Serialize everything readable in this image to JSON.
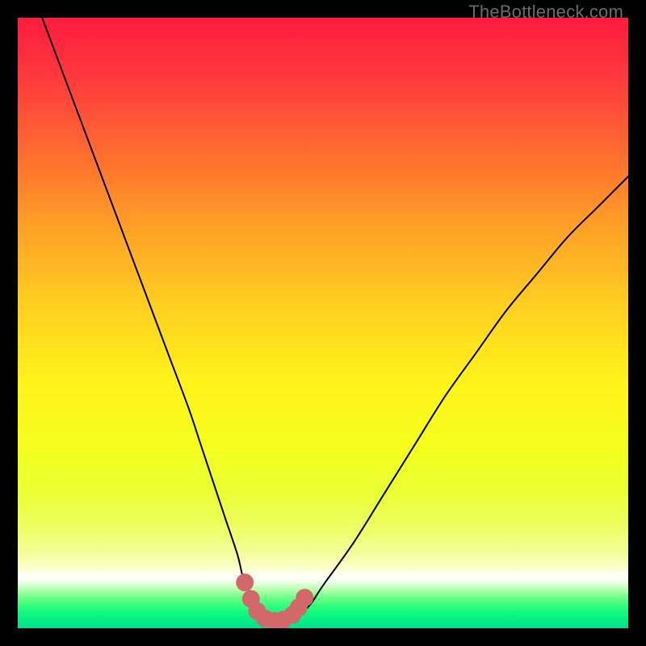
{
  "watermark": "TheBottleneck.com",
  "colors": {
    "frame": "#000000",
    "curve_stroke": "#000000",
    "marker_fill": "#d2686a",
    "gradient_stops": [
      {
        "offset": 0.0,
        "color": "#ff1b3e"
      },
      {
        "offset": 0.1,
        "color": "#ff3a3d"
      },
      {
        "offset": 0.22,
        "color": "#ff6b2f"
      },
      {
        "offset": 0.35,
        "color": "#ffa327"
      },
      {
        "offset": 0.48,
        "color": "#ffd21f"
      },
      {
        "offset": 0.6,
        "color": "#fff31a"
      },
      {
        "offset": 0.7,
        "color": "#f4ff1a"
      },
      {
        "offset": 0.78,
        "color": "#e9ff33"
      },
      {
        "offset": 0.84,
        "color": "#ecff66"
      },
      {
        "offset": 0.885,
        "color": "#f6ffa8"
      },
      {
        "offset": 0.905,
        "color": "#fcffd6"
      },
      {
        "offset": 0.918,
        "color": "#ffffff"
      },
      {
        "offset": 0.926,
        "color": "#e8ffe0"
      },
      {
        "offset": 0.936,
        "color": "#b8ffb0"
      },
      {
        "offset": 0.95,
        "color": "#6dff87"
      },
      {
        "offset": 0.965,
        "color": "#2bff7a"
      },
      {
        "offset": 0.98,
        "color": "#07f582"
      },
      {
        "offset": 1.0,
        "color": "#02e08a"
      }
    ]
  },
  "chart_data": {
    "type": "line",
    "title": "",
    "xlabel": "",
    "ylabel": "",
    "xlim": [
      0,
      100
    ],
    "ylim": [
      0,
      100
    ],
    "grid": false,
    "legend": "none",
    "series": [
      {
        "name": "bottleneck-curve",
        "x": [
          4,
          7,
          10,
          13,
          16,
          19,
          22,
          25,
          28,
          30,
          32,
          34,
          36,
          37,
          38.5,
          40,
          42,
          44,
          46,
          48,
          50,
          55,
          60,
          65,
          70,
          75,
          80,
          85,
          90,
          95,
          100
        ],
        "y": [
          100,
          92,
          84,
          76,
          68,
          60,
          52,
          44,
          36,
          30,
          24,
          18,
          12,
          8,
          5,
          2.5,
          1.2,
          1.2,
          2.0,
          4,
          7,
          14,
          22,
          30,
          38,
          45,
          52,
          58,
          64,
          69,
          74
        ]
      }
    ],
    "markers": {
      "name": "optimal-range",
      "x": [
        37.2,
        38.2,
        39.2,
        40.5,
        42.0,
        43.5,
        45.0,
        46.0,
        47.0
      ],
      "y": [
        7.5,
        4.8,
        2.8,
        1.6,
        1.2,
        1.4,
        2.2,
        3.4,
        5.0
      ]
    }
  }
}
